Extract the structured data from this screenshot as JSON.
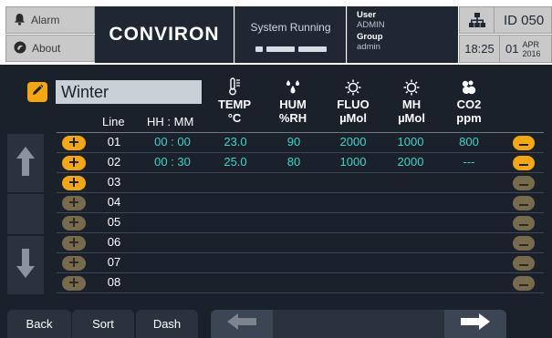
{
  "header": {
    "alarm_label": "Alarm",
    "about_label": "About",
    "logo_text": "CONVIRON",
    "status_text": "System Running",
    "user_label": "User",
    "user_value": "ADMIN",
    "group_label": "Group",
    "group_value": "admin",
    "id_text": "ID  050",
    "time": "18:25",
    "day": "01",
    "month": "APR",
    "year": "2016"
  },
  "program": {
    "name": "Winter"
  },
  "columns": {
    "line": "Line",
    "time": "HH : MM",
    "temp_title": "TEMP",
    "temp_unit": "°C",
    "hum_title": "HUM",
    "hum_unit": "%RH",
    "fluo_title": "FLUO",
    "fluo_unit": "µMol",
    "mh_title": "MH",
    "mh_unit": "µMol",
    "co2_title": "CO2",
    "co2_unit": "ppm"
  },
  "rows": [
    {
      "line": "01",
      "time": "00 : 00",
      "temp": "23.0",
      "hum": "90",
      "fluo": "2000",
      "mh": "1000",
      "co2": "800",
      "active": true
    },
    {
      "line": "02",
      "time": "00 : 30",
      "temp": "25.0",
      "hum": "80",
      "fluo": "1000",
      "mh": "2000",
      "co2": "---",
      "active": true
    },
    {
      "line": "03",
      "time": "",
      "temp": "",
      "hum": "",
      "fluo": "",
      "mh": "",
      "co2": "",
      "active": false
    },
    {
      "line": "04",
      "time": "",
      "temp": "",
      "hum": "",
      "fluo": "",
      "mh": "",
      "co2": "",
      "active": false
    },
    {
      "line": "05",
      "time": "",
      "temp": "",
      "hum": "",
      "fluo": "",
      "mh": "",
      "co2": "",
      "active": false
    },
    {
      "line": "06",
      "time": "",
      "temp": "",
      "hum": "",
      "fluo": "",
      "mh": "",
      "co2": "",
      "active": false
    },
    {
      "line": "07",
      "time": "",
      "temp": "",
      "hum": "",
      "fluo": "",
      "mh": "",
      "co2": "",
      "active": false
    },
    {
      "line": "08",
      "time": "",
      "temp": "",
      "hum": "",
      "fluo": "",
      "mh": "",
      "co2": "",
      "active": false
    }
  ],
  "footer": {
    "back_label": "Back",
    "sort_label": "Sort",
    "dash_label": "Dash"
  },
  "colors": {
    "panel": "#1a212b",
    "accent": "#f5a70f",
    "value": "#3ad6c9"
  }
}
